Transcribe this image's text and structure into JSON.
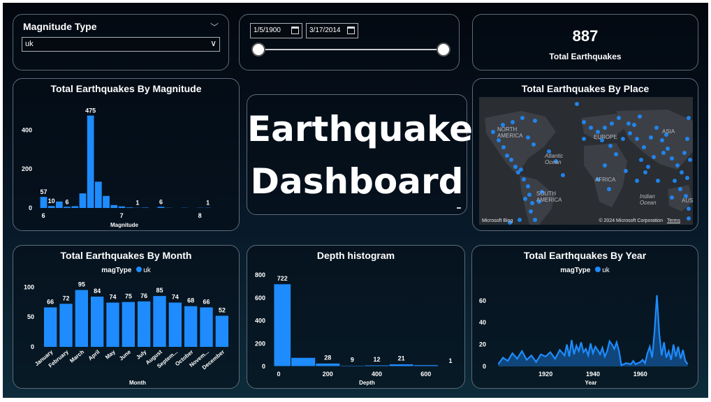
{
  "colors": {
    "accent": "#1e8cff",
    "card_border": "#5d6b7a",
    "background": "#071524"
  },
  "magnitude_slicer": {
    "label": "Magnitude Type",
    "selected": "uk"
  },
  "date_slicer": {
    "start": "1/5/1900",
    "end": "3/17/2014",
    "icon": "calendar-icon"
  },
  "kpi": {
    "value": "887",
    "label": "Total Earthquakes"
  },
  "title_card": {
    "line1": "Earthquake",
    "line2": "Dashboard"
  },
  "map": {
    "title": "Total Earthquakes By Place",
    "labels": {
      "north_america": "NORTH\nAMERICA",
      "europe": "EUROPE",
      "asia": "ASIA",
      "africa": "AFRICA",
      "south_america": "SOUTH\nAMERICA",
      "atlantic": "Atlantic\nOcean",
      "indian": "Indian\nOcean",
      "australia": "AUST"
    },
    "logo": "Microsoft Bing",
    "credit": "© 2024 Microsoft Corporation",
    "terms": "Terms"
  },
  "chart_data": [
    {
      "id": "by_magnitude",
      "type": "bar",
      "title": "Total Earthquakes By Magnitude",
      "xlabel": "Magnitude",
      "ylabel": "",
      "x_tick_labels": [
        "6",
        "7",
        "8"
      ],
      "x_ticks": [
        6,
        7,
        8
      ],
      "yticks": [
        0,
        200,
        400
      ],
      "ylim": [
        0,
        520
      ],
      "xlim": [
        5.95,
        8.2
      ],
      "bin_width": 0.1,
      "x": [
        6.0,
        6.1,
        6.2,
        6.3,
        6.4,
        6.5,
        6.6,
        6.7,
        6.8,
        6.9,
        7.0,
        7.1,
        7.2,
        7.3,
        7.5,
        7.6,
        7.8,
        8.0,
        8.1
      ],
      "values": [
        57,
        10,
        33,
        6,
        9,
        75,
        475,
        135,
        62,
        15,
        8,
        3,
        1,
        2,
        6,
        1,
        1,
        1,
        1
      ],
      "data_labels": {
        "6.0": "57",
        "6.1": "10",
        "6.3": "6",
        "6.6": "475",
        "7.2": "1",
        "7.5": "6",
        "8.1": "1"
      }
    },
    {
      "id": "by_month",
      "type": "bar",
      "title": "Total Earthquakes By Month",
      "legend_title": "magType",
      "series_name": "uk",
      "xlabel": "Month",
      "categories": [
        "January",
        "February",
        "March",
        "April",
        "May",
        "June",
        "July",
        "August",
        "Septem...",
        "October",
        "Novem...",
        "December"
      ],
      "values": [
        66,
        72,
        95,
        84,
        74,
        75,
        76,
        85,
        74,
        68,
        66,
        52
      ],
      "yticks": [
        0,
        50,
        100
      ],
      "ylim": [
        0,
        105
      ]
    },
    {
      "id": "depth_histogram",
      "type": "bar",
      "title": "Depth histogram",
      "xlabel": "Depth",
      "bins": [
        {
          "x0": 0,
          "x1": 50,
          "value": 722
        },
        {
          "x0": 50,
          "x1": 150,
          "value": 78
        },
        {
          "x0": 150,
          "x1": 250,
          "value": 28
        },
        {
          "x0": 250,
          "x1": 350,
          "value": 9
        },
        {
          "x0": 350,
          "x1": 450,
          "value": 12
        },
        {
          "x0": 450,
          "x1": 550,
          "value": 21
        },
        {
          "x0": 550,
          "x1": 650,
          "value": 14
        },
        {
          "x0": 650,
          "x1": 750,
          "value": 1
        }
      ],
      "labeled_bins": [
        0,
        2,
        3,
        4,
        5,
        7
      ],
      "xticks": [
        0,
        200,
        400,
        600
      ],
      "yticks": [
        0,
        200,
        400,
        600,
        800
      ],
      "xlim": [
        -20,
        740
      ],
      "ylim": [
        0,
        800
      ]
    },
    {
      "id": "by_year",
      "type": "area",
      "title": "Total Earthquakes By Year",
      "legend_title": "magType",
      "series_name": "uk",
      "xlabel": "Year",
      "xticks": [
        1920,
        1940,
        1960
      ],
      "yticks": [
        0,
        20,
        40,
        60
      ],
      "xlim": [
        1899,
        1981
      ],
      "ylim": [
        0,
        72
      ],
      "x": [
        1900,
        1902,
        1904,
        1906,
        1908,
        1910,
        1912,
        1914,
        1916,
        1918,
        1920,
        1922,
        1924,
        1926,
        1928,
        1929,
        1930,
        1931,
        1932,
        1933,
        1934,
        1935,
        1936,
        1937,
        1938,
        1939,
        1940,
        1941,
        1942,
        1943,
        1944,
        1945,
        1946,
        1947,
        1948,
        1949,
        1950,
        1951,
        1952,
        1954,
        1956,
        1957,
        1958,
        1960,
        1961,
        1962,
        1963,
        1964,
        1965,
        1966,
        1967,
        1968,
        1969,
        1970,
        1971,
        1972,
        1973,
        1974,
        1975,
        1976,
        1977,
        1978,
        1979,
        1980
      ],
      "y": [
        2,
        8,
        5,
        12,
        7,
        14,
        6,
        10,
        4,
        11,
        9,
        13,
        7,
        15,
        10,
        20,
        9,
        24,
        11,
        19,
        14,
        22,
        13,
        16,
        10,
        21,
        12,
        18,
        15,
        11,
        17,
        9,
        14,
        23,
        20,
        16,
        22,
        14,
        1,
        3,
        2,
        5,
        2,
        4,
        6,
        3,
        12,
        18,
        8,
        32,
        65,
        30,
        10,
        22,
        8,
        14,
        6,
        20,
        9,
        18,
        7,
        15,
        5,
        2
      ]
    }
  ]
}
